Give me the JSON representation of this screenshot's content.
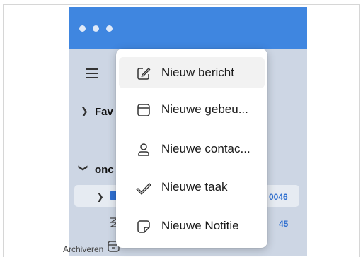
{
  "sidebar": {
    "favorites_label": "Fav",
    "account_label": "onc",
    "folder_count_1": "0046",
    "folder_count_2": "45",
    "archive_label": "Archiveren"
  },
  "new_menu": {
    "items": [
      {
        "label": "Nieuw bericht",
        "icon": "compose-icon"
      },
      {
        "label": "Nieuwe gebeu...",
        "icon": "calendar-icon"
      },
      {
        "label": "Nieuwe contac...",
        "icon": "person-icon"
      },
      {
        "label": "Nieuwe taak",
        "icon": "checkmark-icon"
      },
      {
        "label": "Nieuwe Notitie",
        "icon": "note-icon"
      }
    ]
  },
  "colors": {
    "titlebar": "#3f86e0",
    "sidebar": "#cdd6e4",
    "accent_count": "#2f6fd0"
  }
}
